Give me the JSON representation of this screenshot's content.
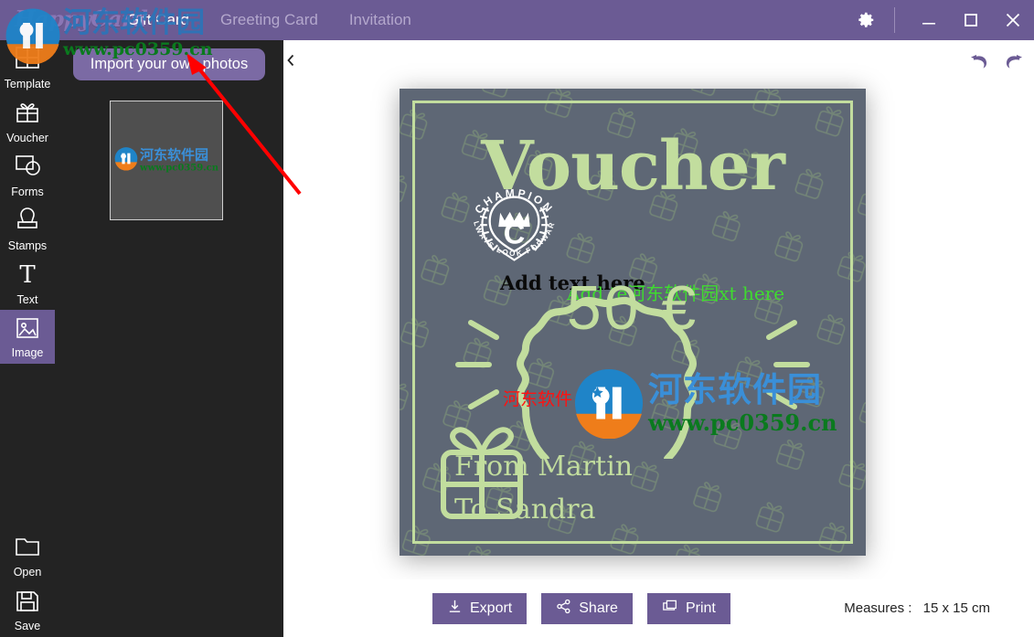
{
  "app": {
    "logo": "HappyCard",
    "brand_color": "#6b5b94",
    "panel_color": "#232323",
    "card_bg": "#5e6775",
    "card_accent": "#c2dd9e"
  },
  "titlebar": {
    "tabs": [
      {
        "label": "Gift Card",
        "active": true
      },
      {
        "label": "Greeting Card",
        "active": false
      },
      {
        "label": "Invitation",
        "active": false
      }
    ],
    "settings_icon": "gear-icon",
    "minimize_icon": "minimize-icon",
    "maximize_icon": "maximize-icon",
    "close_icon": "close-icon"
  },
  "sidebar": {
    "items": [
      {
        "label": "Template",
        "icon": "grid-icon",
        "selected": false
      },
      {
        "label": "Voucher",
        "icon": "gift-icon",
        "selected": false
      },
      {
        "label": "Forms",
        "icon": "shapes-icon",
        "selected": false
      },
      {
        "label": "Stamps",
        "icon": "stamp-icon",
        "selected": false
      },
      {
        "label": "Text",
        "icon": "text-t-icon",
        "selected": false
      },
      {
        "label": "Image",
        "icon": "image-icon",
        "selected": true
      }
    ],
    "bottom_items": [
      {
        "label": "Open",
        "icon": "folder-icon"
      },
      {
        "label": "Save",
        "icon": "floppy-disk-icon"
      }
    ]
  },
  "panel": {
    "import_button": "Import your own photos",
    "collapse_icon": "chevron-left-icon",
    "thumbnail_name": "image-thumbnail"
  },
  "canvas": {
    "undo_icon": "undo-arrow-icon",
    "redo_icon": "redo-arrow-icon"
  },
  "card": {
    "title": "Voucher",
    "amount": "50 €",
    "text_black": "Add text here",
    "text_green": "Add te河东软件园xt here",
    "from_line": "From Martin",
    "to_line": "To Sandra",
    "badge_top_text": "CHAMPION",
    "badge_bottom_text": "ALWAYS LOOK FORWARD",
    "badge_letter": "C",
    "watermark_red": "河东软件"
  },
  "watermark": {
    "cn_text": "河东软件园",
    "url_text": "www.pc0359.cn",
    "logo_digits": "1D"
  },
  "bottom": {
    "export_label": "Export",
    "export_icon": "download-icon",
    "share_label": "Share",
    "share_icon": "share-nodes-icon",
    "print_label": "Print",
    "print_icon": "printer-icon",
    "measures_label": "Measures :",
    "measures_value": "15 x 15 cm"
  }
}
